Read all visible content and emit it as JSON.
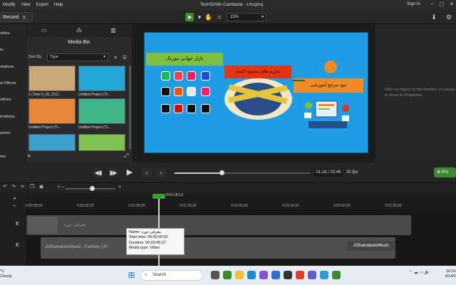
{
  "menubar": [
    "Modify",
    "View",
    "Export",
    "Help"
  ],
  "app_title": "TechSmith Camtasia - t.tscproj",
  "signin": "Sign In",
  "record_label": "Record",
  "zoom": "15%",
  "nav_items": [
    "orites",
    "ia",
    "otations",
    "al Effects",
    "sitions",
    "imations",
    "aviors",
    "ore"
  ],
  "panel": {
    "title": "Media Bin",
    "sort_label": "Sort By",
    "sort_value": "Type",
    "media": [
      {
        "label": "1 (Time 0_00_23;2...",
        "color": "#c9a87a"
      },
      {
        "label": "Untitled Project (Ti...",
        "color": "#22a7d6"
      },
      {
        "label": "Untitled Project (Ti...",
        "color": "#e9863a"
      },
      {
        "label": "Untitled Project (Ti...",
        "color": "#3eb58a"
      },
      {
        "label": "",
        "color": "#3aa0cf"
      },
      {
        "label": "",
        "color": "#7fc04f"
      }
    ]
  },
  "canvas": {
    "green_label": "بازار جهانی موزیک",
    "red_label": "تحریم های محدود کننده",
    "orange_label": "نبود مرجع آموزشی"
  },
  "right_hint": "Click an object on the timeline or canvas to show its Properties",
  "playback": {
    "timecode": "01:18 / 03:45",
    "fps": "30 fps",
    "produce": "Pro"
  },
  "timeline": {
    "playhead_time": "0:01:18;13",
    "ticks": [
      "0:00:00;00",
      "0:00:30;00",
      "0:01:00;00",
      "0:01:30;00",
      "0:02:00;00",
      "0:02:30;00",
      "0:03:00;00",
      "0:03:30;00"
    ],
    "clip1_label": "معرفی دوره",
    "clip2_label": "AShamaluevMusic - Fashion (20",
    "clip2_logo": "AShamaluevMusic"
  },
  "tooltip": {
    "name": "Name: معرفی دوره",
    "start": "Start time: 00:00:00;00",
    "duration": "Duration: 00:03:45;27",
    "type": "Media type: Video"
  },
  "taskbar": {
    "weather_temp": "°C",
    "weather_text": "Cloudy",
    "search": "Search",
    "time": "10:31",
    "date": "4/14/2"
  }
}
